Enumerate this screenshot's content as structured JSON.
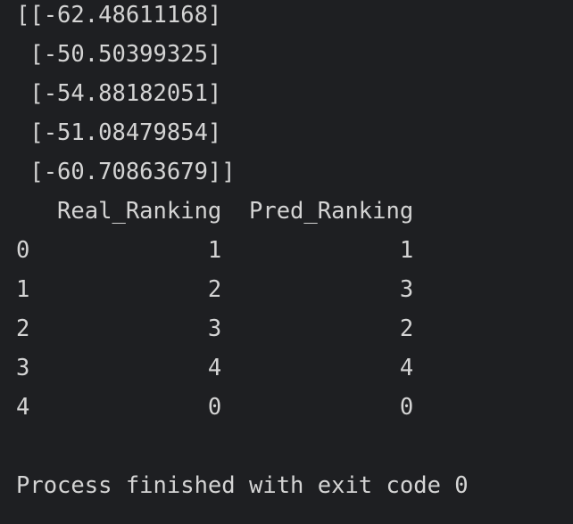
{
  "console": {
    "lines": [
      "[[-62.48611168]",
      " [-50.50399325]",
      " [-54.88182051]",
      " [-51.08479854]",
      " [-60.70863679]]",
      "   Real_Ranking  Pred_Ranking",
      "0             1             1",
      "1             2             3",
      "2             3             2",
      "3             4             4",
      "4             0             0",
      "",
      "Process finished with exit code 0"
    ]
  },
  "colors": {
    "background": "#1e1f22",
    "text": "#d4d4d4"
  }
}
